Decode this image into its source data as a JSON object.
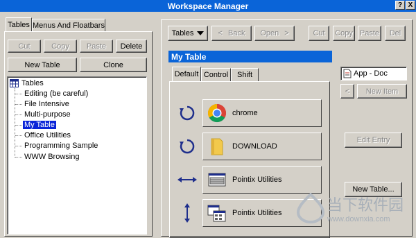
{
  "window": {
    "title": "Workspace Manager",
    "help_glyph": "?",
    "close_glyph": "X"
  },
  "left_tabs": [
    "Tables",
    "Menus And Floatbars"
  ],
  "left_buttons": {
    "cut": "Cut",
    "copy": "Copy",
    "paste": "Paste",
    "delete": "Delete",
    "new_table": "New Table",
    "clone": "Clone"
  },
  "tree": {
    "root": "Tables",
    "items": [
      "Editing (be careful)",
      "File Intensive",
      "Multi-purpose",
      "My Table",
      "Office Utilities",
      "Programming Sample",
      "WWW Browsing"
    ],
    "selected": "My Table"
  },
  "toolbar": {
    "tables_dropdown": "Tables",
    "back": "Back",
    "open": "Open",
    "cut": "Cut",
    "copy": "Copy",
    "paste": "Paste",
    "del": "Del"
  },
  "table_title": "My Table",
  "inner_tabs": [
    "Default",
    "Control",
    "Shift"
  ],
  "entries": [
    {
      "action_icon": "rotate-icon",
      "target_icon": "chrome-icon",
      "label": "chrome"
    },
    {
      "action_icon": "rotate-icon",
      "target_icon": "folder-icon",
      "label": "DOWNLOAD"
    },
    {
      "action_icon": "horizontal-arrows-icon",
      "target_icon": "keyboard-window-icon",
      "label": "Pointix Utilities"
    },
    {
      "action_icon": "vertical-arrows-icon",
      "target_icon": "window-grid-icon",
      "label": "Pointix Utilities"
    }
  ],
  "right_panel": {
    "app_doc": "App - Doc",
    "back_glyph": "<",
    "new_item": "New Item",
    "edit_entry": "Edit Entry",
    "new_table": "New Table..."
  },
  "watermark": {
    "brand": "当下软件园",
    "url": "www.downxia.com"
  },
  "colors": {
    "title_blue": "#0a64d8",
    "selection_blue": "#0a24d8",
    "face": "#d4d0c8"
  }
}
